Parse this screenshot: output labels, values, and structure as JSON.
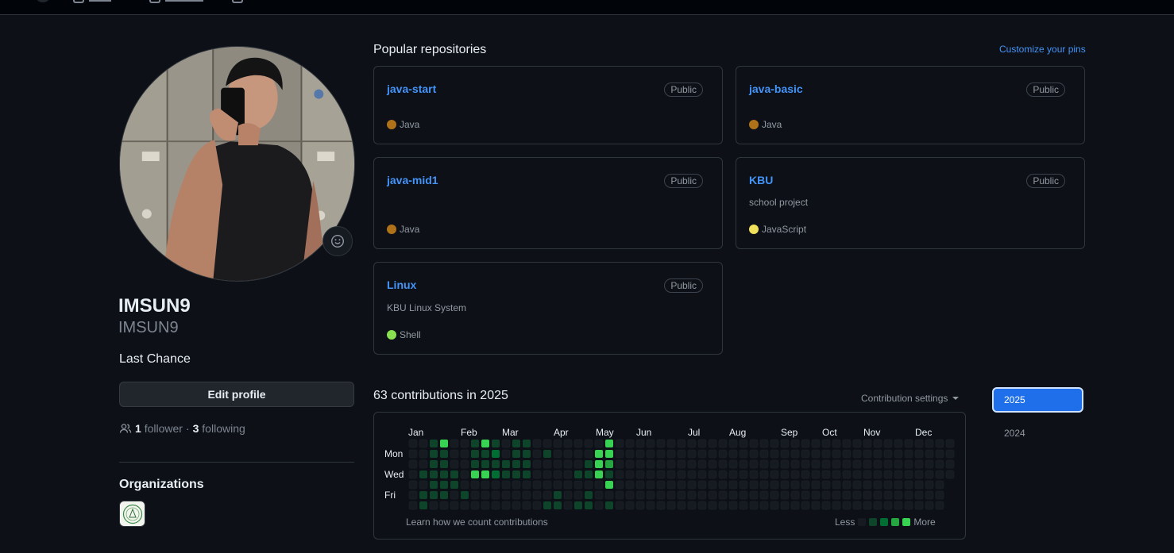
{
  "colors": {
    "bg": "#0d1117",
    "accent": "#4493f8",
    "border": "#30363d",
    "java": "#b07219",
    "javascript": "#f1e05a",
    "shell": "#89e051",
    "year_active": "#1f6feb"
  },
  "profile": {
    "display_name": "IMSUN9",
    "login": "IMSUN9",
    "bio": "Last Chance",
    "edit_label": "Edit profile",
    "followers_count": "1",
    "followers_label": "follower",
    "sep": "·",
    "following_count": "3",
    "following_label": "following",
    "organizations_title": "Organizations",
    "people_icon": "people-icon",
    "emoji_icon": "smiley-icon"
  },
  "pinned": {
    "title": "Popular repositories",
    "customize_label": "Customize your pins",
    "repos": [
      {
        "name": "java-start",
        "visibility": "Public",
        "description": "",
        "language": "Java",
        "lang_color": "#b07219"
      },
      {
        "name": "java-basic",
        "visibility": "Public",
        "description": "",
        "language": "Java",
        "lang_color": "#b07219"
      },
      {
        "name": "java-mid1",
        "visibility": "Public",
        "description": "",
        "language": "Java",
        "lang_color": "#b07219"
      },
      {
        "name": "KBU",
        "visibility": "Public",
        "description": "school project",
        "language": "JavaScript",
        "lang_color": "#f1e05a"
      },
      {
        "name": "Linux",
        "visibility": "Public",
        "description": "KBU Linux System",
        "language": "Shell",
        "lang_color": "#89e051"
      }
    ]
  },
  "contributions": {
    "title": "63 contributions in 2025",
    "settings_label": "Contribution settings",
    "months": [
      "Jan",
      "Feb",
      "Mar",
      "Apr",
      "May",
      "Jun",
      "Jul",
      "Aug",
      "Sep",
      "Oct",
      "Nov",
      "Dec"
    ],
    "day_labels": [
      "Mon",
      "Wed",
      "Fri"
    ],
    "learn_label": "Learn how we count contributions",
    "legend_less": "Less",
    "legend_more": "More",
    "level_colors": [
      "#161b22",
      "#0e4429",
      "#006d32",
      "#26a641",
      "#39d353"
    ],
    "levels": {
      "0": "0000000",
      "1": "0001011",
      "2": "1111110",
      "3": "4111110",
      "4": "0001100",
      "5": "0000010",
      "6": "1114000",
      "7": "4114000",
      "8": "1212000",
      "9": "0011000",
      "10": "1111000",
      "11": "1111000",
      "12": "0000000",
      "13": "0100001",
      "14": "0000011",
      "15": "0000000",
      "16": "0001001",
      "17": "0011011",
      "18": "0444000",
      "19": "4431401"
    },
    "years": [
      "2025",
      "2024"
    ]
  }
}
